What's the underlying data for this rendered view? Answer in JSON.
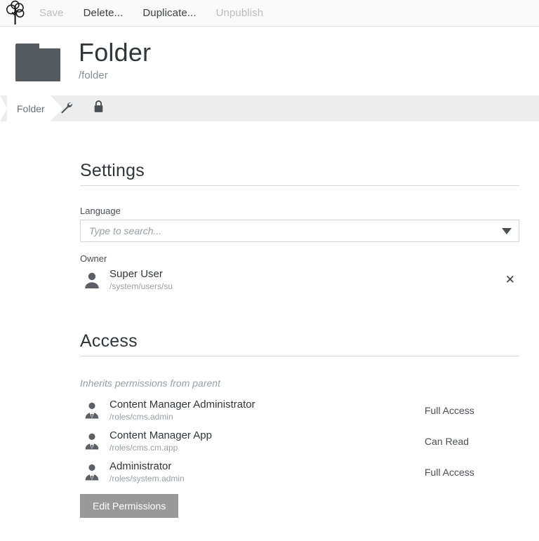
{
  "app": {
    "logo_icon": "magnolia-tree-logo"
  },
  "toolbar": {
    "actions": [
      {
        "label": "Save",
        "enabled": false
      },
      {
        "label": "Delete...",
        "enabled": true
      },
      {
        "label": "Duplicate...",
        "enabled": true
      },
      {
        "label": "Unpublish",
        "enabled": false
      }
    ]
  },
  "header": {
    "icon": "folder-icon",
    "title": "Folder",
    "subtitle": "/folder"
  },
  "tabs": [
    {
      "label": "Folder",
      "icon": null,
      "active": true
    },
    {
      "label": "",
      "icon": "wrench-icon",
      "active": false
    },
    {
      "label": "",
      "icon": "lock-icon",
      "active": false
    }
  ],
  "settings": {
    "heading": "Settings",
    "language": {
      "label": "Language",
      "value": "",
      "placeholder": "Type to search...",
      "caret_icon": "chevron-down-icon"
    },
    "owner": {
      "label": "Owner",
      "icon": "user-avatar-icon",
      "name": "Super User",
      "path": "/system/users/su",
      "remove_icon": "close-icon",
      "remove_label": "✕"
    }
  },
  "access": {
    "heading": "Access",
    "inherit_note": "Inherits permissions from parent",
    "roles": [
      {
        "icon": "role-user-icon",
        "name": "Content Manager Administrator",
        "path": "/roles/cms.admin",
        "permission": "Full Access"
      },
      {
        "icon": "role-user-icon",
        "name": "Content Manager App",
        "path": "/roles/cms.cm.app",
        "permission": "Can Read"
      },
      {
        "icon": "role-user-icon",
        "name": "Administrator",
        "path": "/roles/system.admin",
        "permission": "Full Access"
      }
    ],
    "edit_button": "Edit Permissions"
  },
  "colors": {
    "icon_dark": "#555a61",
    "title": "#31363b",
    "muted": "#9aa0a5",
    "button_gray": "#999999",
    "tabbar_bg": "#ededed"
  }
}
